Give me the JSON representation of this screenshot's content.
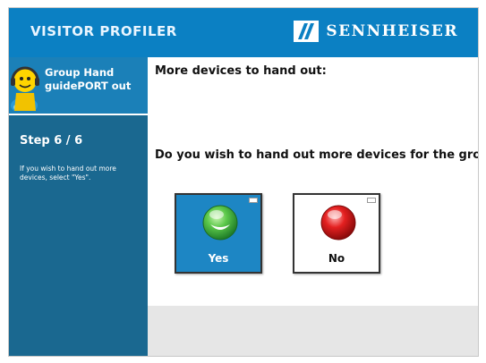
{
  "header": {
    "app_title": "VISITOR PROFILER",
    "brand": "SENNHEISER"
  },
  "sidebar": {
    "mode_title": "Group Hand guidePORT out",
    "step": "Step 6 / 6",
    "hint": "If you wish to hand out more devices, select \"Yes\"."
  },
  "main": {
    "title": "More devices to hand out:",
    "question": "Do you wish to hand out more devices for the group?",
    "yes_label": "Yes",
    "no_label": "No"
  },
  "colors": {
    "header_blue": "#0b80c3",
    "sidebar_blue": "#1a6890",
    "yes_green": "#3ab04a",
    "no_red": "#d8141a"
  }
}
